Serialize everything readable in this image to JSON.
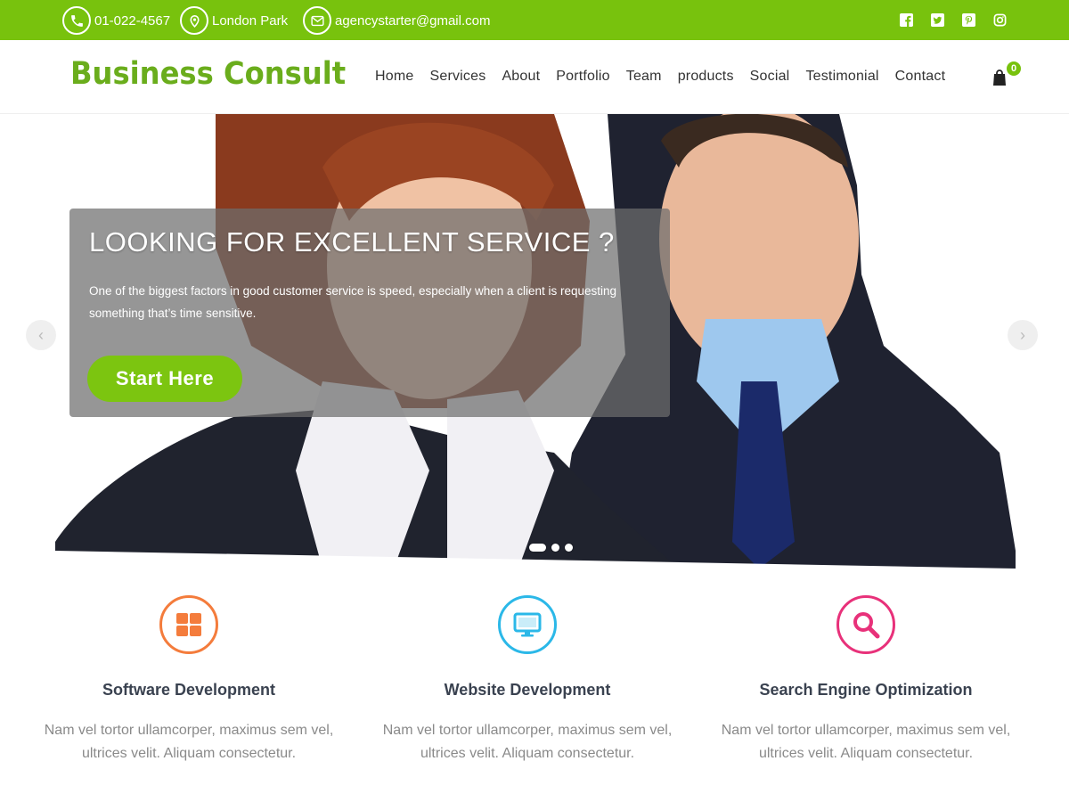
{
  "topbar": {
    "phone": "01-022-4567",
    "location": "London Park",
    "email": "agencystarter@gmail.com",
    "social": [
      "facebook-icon",
      "twitter-icon",
      "pinterest-icon",
      "instagram-icon"
    ]
  },
  "header": {
    "logo": "Business Consult",
    "nav": [
      "Home",
      "Services",
      "About",
      "Portfolio",
      "Team",
      "products",
      "Social",
      "Testimonial",
      "Contact"
    ],
    "cart_count": "0"
  },
  "hero": {
    "title": "LOOKING FOR EXCELLENT SERVICE ?",
    "text": "One of the biggest factors in good customer service is speed, especially when a client is requesting something that’s time sensitive.",
    "button": "Start Here",
    "prev": "‹",
    "next": "›"
  },
  "services": [
    {
      "title": "Software Development",
      "desc": "Nam vel tortor ullamcorper, maximus sem vel, ultrices velit. Aliquam consectetur.",
      "icon": "grid-icon",
      "color": "#f47c3c"
    },
    {
      "title": "Website Development",
      "desc": "Nam vel tortor ullamcorper, maximus sem vel, ultrices velit. Aliquam consectetur.",
      "icon": "monitor-icon",
      "color": "#2bb8e8"
    },
    {
      "title": "Search Engine Optimization",
      "desc": "Nam vel tortor ullamcorper, maximus sem vel, ultrices velit. Aliquam consectetur.",
      "icon": "search-icon",
      "color": "#e8317a"
    }
  ],
  "colors": {
    "brand": "#78c20d",
    "logo": "#6aad1c"
  }
}
